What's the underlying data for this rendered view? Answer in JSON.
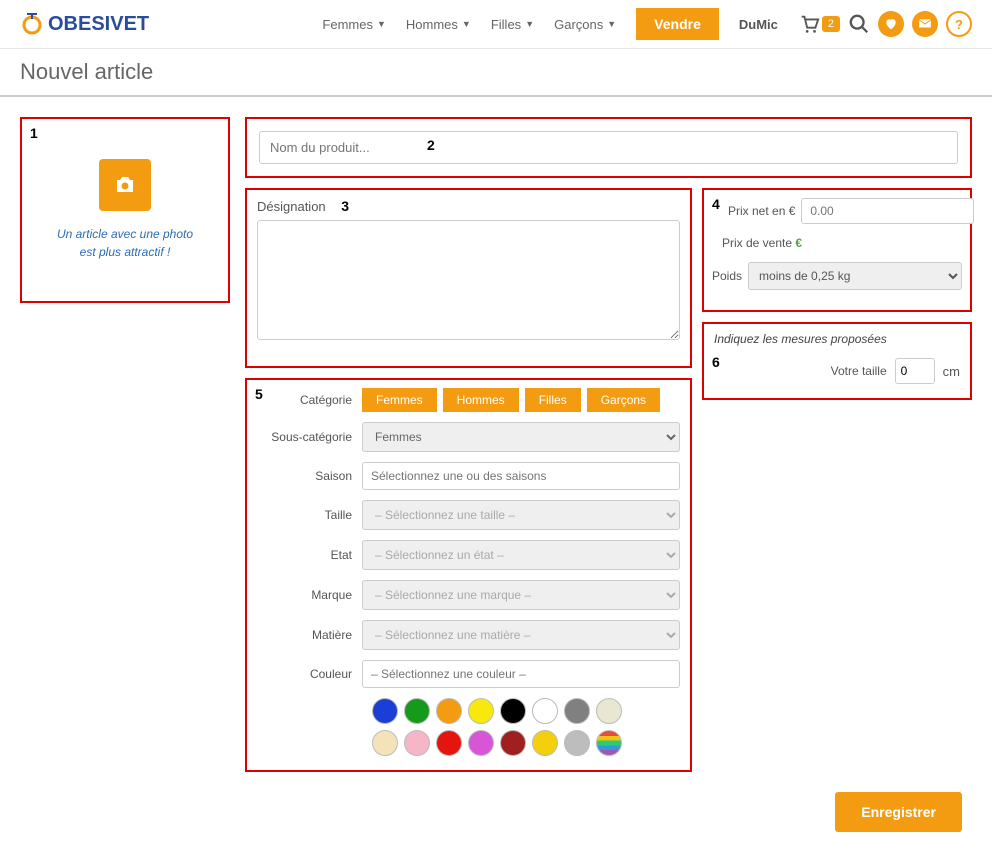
{
  "header": {
    "logo": "OBESIVET",
    "nav": [
      "Femmes",
      "Hommes",
      "Filles",
      "Garçons"
    ],
    "sell": "Vendre",
    "user": "DuMic",
    "cart_count": "2"
  },
  "page_title": "Nouvel article",
  "panel1": {
    "num": "1",
    "text_l1": "Un article avec une photo",
    "text_l2": "est plus attractif !"
  },
  "panel2": {
    "num": "2",
    "placeholder": "Nom du produit..."
  },
  "panel3": {
    "num": "3",
    "label": "Désignation"
  },
  "panel4": {
    "num": "4",
    "price_label": "Prix net en €",
    "price_placeholder": "0.00",
    "sale_label": "Prix de vente",
    "weight_label": "Poids",
    "weight_selected": "moins de 0,25 kg"
  },
  "panel5": {
    "num": "5",
    "labels": {
      "categorie": "Catégorie",
      "sous_categorie": "Sous-catégorie",
      "saison": "Saison",
      "taille": "Taille",
      "etat": "Etat",
      "marque": "Marque",
      "matiere": "Matière",
      "couleur": "Couleur"
    },
    "cat_buttons": [
      "Femmes",
      "Hommes",
      "Filles",
      "Garçons"
    ],
    "sous_cat_selected": "Femmes",
    "saison_ph": "Sélectionnez une ou des saisons",
    "taille_ph": "– Sélectionnez une taille –",
    "etat_ph": "– Sélectionnez un état –",
    "marque_ph": "– Sélectionnez une marque –",
    "matiere_ph": "– Sélectionnez une matière –",
    "couleur_ph": "– Sélectionnez une couleur –",
    "colors": [
      "#1a3fd6",
      "#159a1b",
      "#f39c12",
      "#f7e90c",
      "#000000",
      "#ffffff",
      "#808080",
      "#e9e6d2",
      "#f4e3b8",
      "#f7b5c8",
      "#e3150e",
      "#d756d7",
      "#a02020",
      "#f3d00b",
      "#bdbdbd",
      "rainbow"
    ]
  },
  "panel6": {
    "num": "6",
    "title": "Indiquez les mesures proposées",
    "size_label": "Votre taille",
    "size_value": "0",
    "size_unit": "cm"
  },
  "save_label": "Enregistrer"
}
